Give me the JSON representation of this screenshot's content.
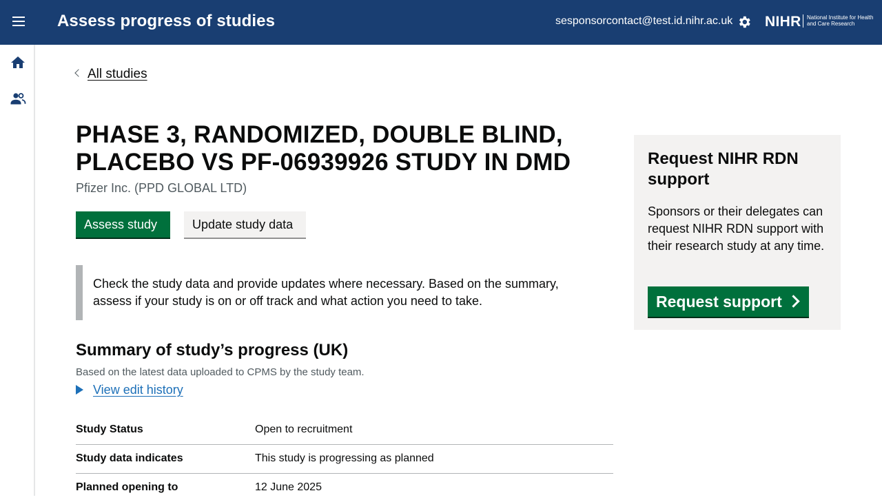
{
  "header": {
    "app_title": "Assess progress of studies",
    "user_email": "sesponsorcontact@test.id.nihr.ac.uk",
    "logo_mark": "NIHR",
    "logo_sub": "National Institute for Health and Care Research",
    "menu_icon": "hamburger-menu-icon",
    "settings_icon": "gear-icon",
    "background_color": "#193e72"
  },
  "sidebar": {
    "items": [
      {
        "icon": "home-icon"
      },
      {
        "icon": "users-icon"
      }
    ]
  },
  "main": {
    "back_link": "All studies",
    "study_title": "PHASE 3, RANDOMIZED, DOUBLE BLIND, PLACEBO VS PF-06939926 STUDY IN DMD",
    "sponsor": "Pfizer Inc. (PPD GLOBAL LTD)",
    "buttons": {
      "assess": "Assess study",
      "update": "Update study data"
    },
    "inset_text": "Check the study data and provide updates where necessary. Based on the summary, assess if your study is on or off track and what action you need to take.",
    "summary": {
      "heading": "Summary of study’s progress (UK)",
      "subtext": "Based on the latest data uploaded to CPMS by the study team.",
      "details_link": "View edit history",
      "rows": [
        {
          "key": "Study Status",
          "value": "Open to recruitment"
        },
        {
          "key": "Study data indicates",
          "value": "This study is progressing as planned"
        },
        {
          "key": "Planned opening to",
          "value": "12 June 2025"
        }
      ]
    }
  },
  "panel": {
    "heading": "Request NIHR RDN support",
    "body": "Sponsors or their delegates can request NIHR RDN support with their research study at any time.",
    "button": "Request support"
  },
  "colors": {
    "primary_green": "#00703c",
    "link_blue": "#1d70b8",
    "panel_grey": "#f3f2f1"
  }
}
